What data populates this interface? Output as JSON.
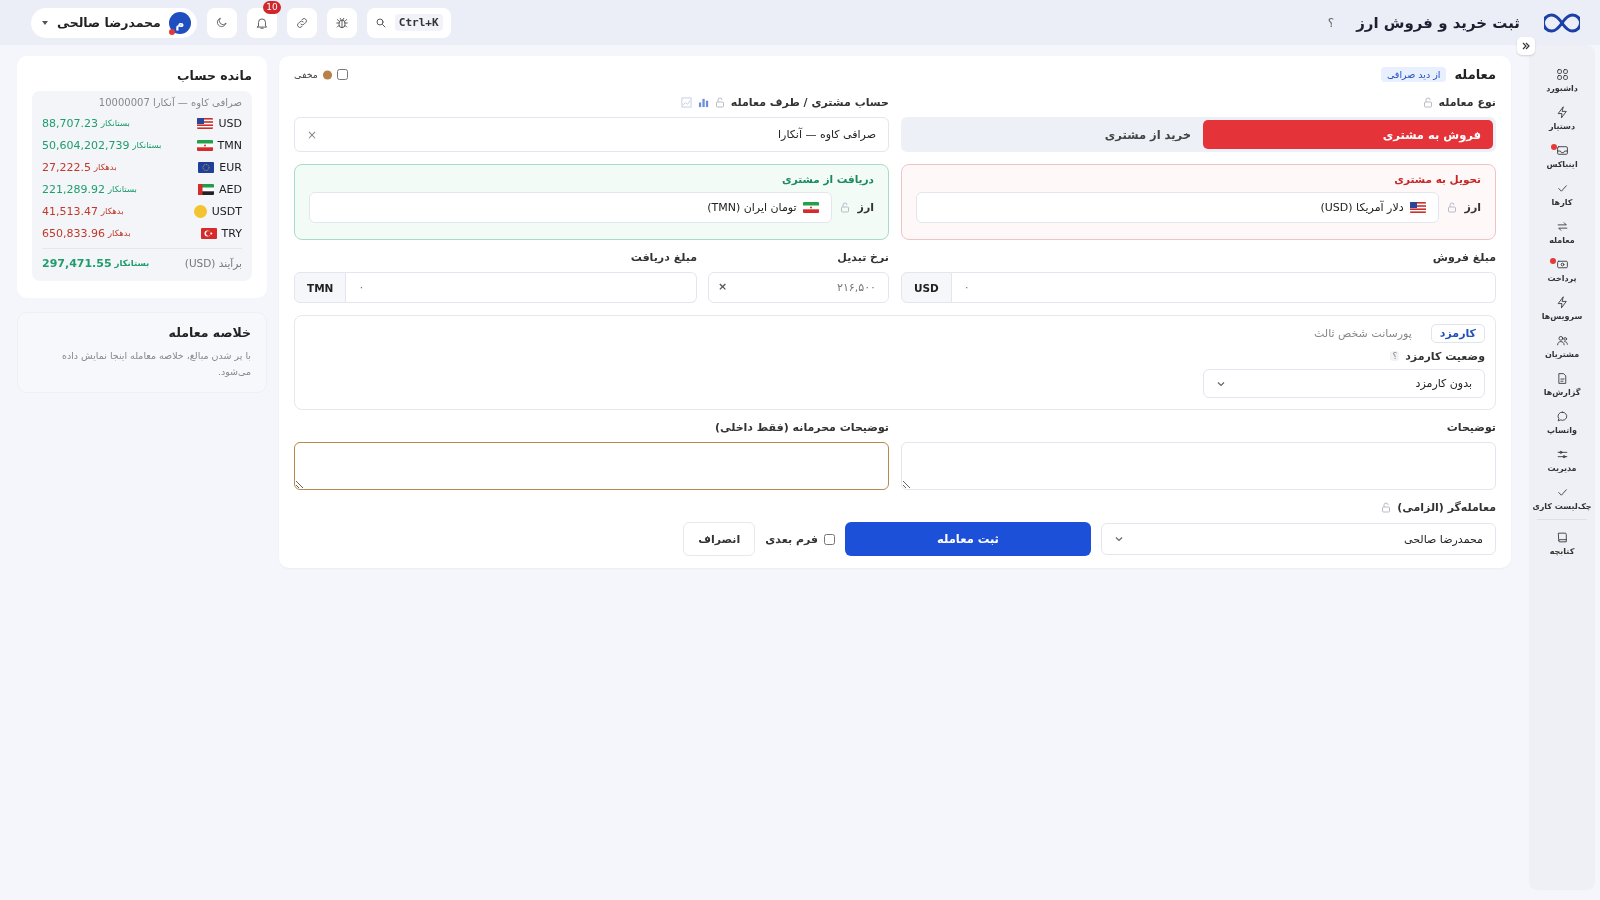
{
  "topbar": {
    "title": "ثبت خرید و فروش ارز",
    "help": "؟",
    "search_shortcut": "Ctrl+K",
    "notification_count": "10",
    "user": {
      "initial": "م",
      "name": "محمدرضا صالحی"
    }
  },
  "sidebar": {
    "items": [
      {
        "label": "داشبورد",
        "kind": "grid",
        "alert": false
      },
      {
        "label": "دستیار",
        "kind": "bolt",
        "alert": false
      },
      {
        "label": "اینباکس",
        "kind": "inbox",
        "alert": true
      },
      {
        "label": "کارها",
        "kind": "check",
        "alert": false
      },
      {
        "label": "معامله",
        "kind": "swap",
        "alert": false
      },
      {
        "label": "پرداخت",
        "kind": "cash",
        "alert": true
      },
      {
        "label": "سرویس‌ها",
        "kind": "bolt",
        "alert": false
      },
      {
        "label": "مشتریان",
        "kind": "users",
        "alert": false
      },
      {
        "label": "گزارش‌ها",
        "kind": "doc",
        "alert": false
      },
      {
        "label": "واتساپ",
        "kind": "chat",
        "alert": false
      },
      {
        "label": "مدیریت",
        "kind": "sliders",
        "alert": false
      },
      {
        "label": "چک‌لیست کاری",
        "kind": "check",
        "alert": false
      },
      {
        "label": "کتابچه",
        "kind": "book",
        "alert": false
      }
    ]
  },
  "trade": {
    "title": "معامله",
    "view_badge": "از دید صرافی",
    "hidden_toggle": {
      "label": "مخفی",
      "checked": false
    },
    "trade_type": {
      "label": "نوع معامله",
      "options": [
        {
          "label": "فروش به مشتری",
          "selected": true
        },
        {
          "label": "خرید از مشتری",
          "selected": false
        }
      ]
    },
    "account": {
      "label": "حساب مشتری / طرف معامله",
      "value": "صرافی کاوه — آنکارا",
      "clear": "×"
    },
    "deliver": {
      "title": "تحویل به مشتری",
      "currency_label": "ارز",
      "currency": "دلار آمریکا (USD)",
      "kind": "us"
    },
    "receive": {
      "title": "دریافت از مشتری",
      "currency_label": "ارز",
      "currency": "تومان ایران (TMN)",
      "kind": "ir"
    },
    "sale_amount": {
      "label": "مبلغ فروش",
      "unit": "USD",
      "placeholder": "۰"
    },
    "rate": {
      "label": "نرخ تبدیل",
      "placeholder": "۲۱۶,۵۰۰",
      "clear": "×"
    },
    "receive_amount": {
      "label": "مبلغ دریافت",
      "unit": "TMN",
      "placeholder": "۰"
    },
    "fee": {
      "tabs": [
        {
          "label": "کارمزد",
          "selected": true
        },
        {
          "label": "پورسانت شخص ثالث",
          "selected": false
        }
      ],
      "status_label": "وضعیت کارمزد",
      "help": "؟",
      "status_value": "بدون کارمزد"
    },
    "notes": {
      "label": "توضیحات"
    },
    "private_notes": {
      "label": "توضیحات محرمانه (فقط داخلی)"
    },
    "dealer": {
      "label": "معامله‌گر (الزامی)",
      "value": "محمدرضا صالحی"
    },
    "submit": "ثبت معامله",
    "next_form": {
      "label": "فرم بعدی",
      "checked": false
    },
    "cancel": "انصراف"
  },
  "balance": {
    "title": "مانده حساب",
    "account": "صرافی کاوه — آنکارا 10000007",
    "rows": [
      {
        "currency": "USD",
        "kind": "us",
        "status": "بستانکار",
        "amount": "88,707.23",
        "color": "#1f9d6b"
      },
      {
        "currency": "TMN",
        "kind": "ir",
        "status": "بستانکار",
        "amount": "50,604,202,739",
        "color": "#1f9d6b"
      },
      {
        "currency": "EUR",
        "kind": "eu",
        "status": "بدهکار",
        "amount": "27,222.5",
        "color": "#c0392b"
      },
      {
        "currency": "AED",
        "kind": "ae",
        "status": "بستانکار",
        "amount": "221,289.92",
        "color": "#1f9d6b"
      },
      {
        "currency": "USDT",
        "kind": "coin",
        "status": "بدهکار",
        "amount": "41,513.47",
        "color": "#c0392b"
      },
      {
        "currency": "TRY",
        "kind": "tr",
        "status": "بدهکار",
        "amount": "650,833.96",
        "color": "#c0392b"
      }
    ],
    "total": {
      "label": "برآیند (USD)",
      "status": "بستانکار",
      "amount": "297,471.55",
      "color": "#1f9d6b"
    }
  },
  "summary": {
    "title": "خلاصه معامله",
    "text": "با پر شدن مبالغ، خلاصه معامله اینجا نمایش داده می‌شود."
  }
}
